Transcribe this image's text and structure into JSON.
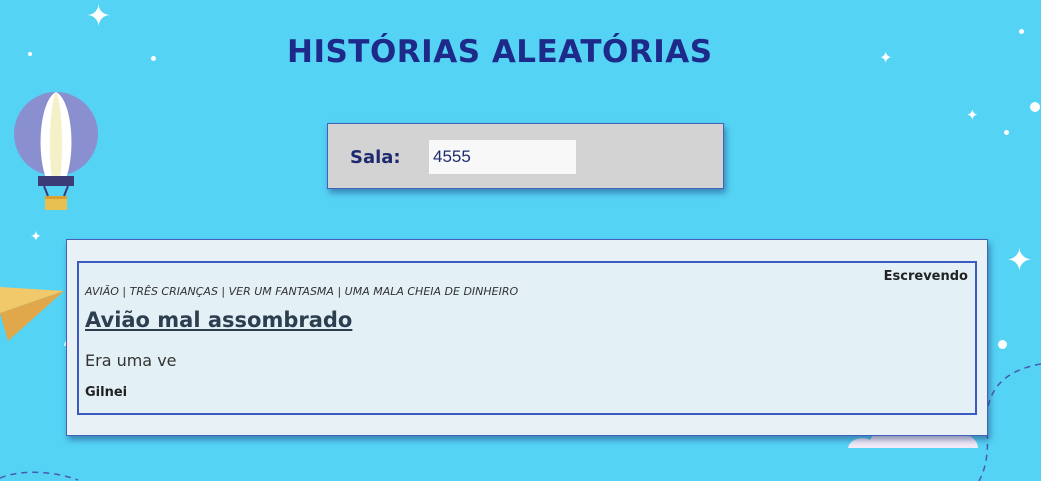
{
  "header": {
    "title": "HISTÓRIAS ALEATÓRIAS"
  },
  "room": {
    "label": "Sala:",
    "value": "4555"
  },
  "story": {
    "status": "Escrevendo",
    "tags": "AVIÃO | TRÊS CRIANÇAS | VER UM FANTASMA | UMA MALA CHEIA DE DINHEIRO",
    "title": "Avião mal assombrado",
    "text": "Era uma ve",
    "author": "Gilnei"
  },
  "decorations": {
    "icons": [
      "hot-air-balloon-icon",
      "paper-plane-icon",
      "cloud-icon",
      "sparkle-icon"
    ]
  },
  "colors": {
    "background": "#55d3f5",
    "title": "#1e2a8a",
    "panel_border": "#3c5bc0",
    "room_box": "#d3d3d3"
  }
}
